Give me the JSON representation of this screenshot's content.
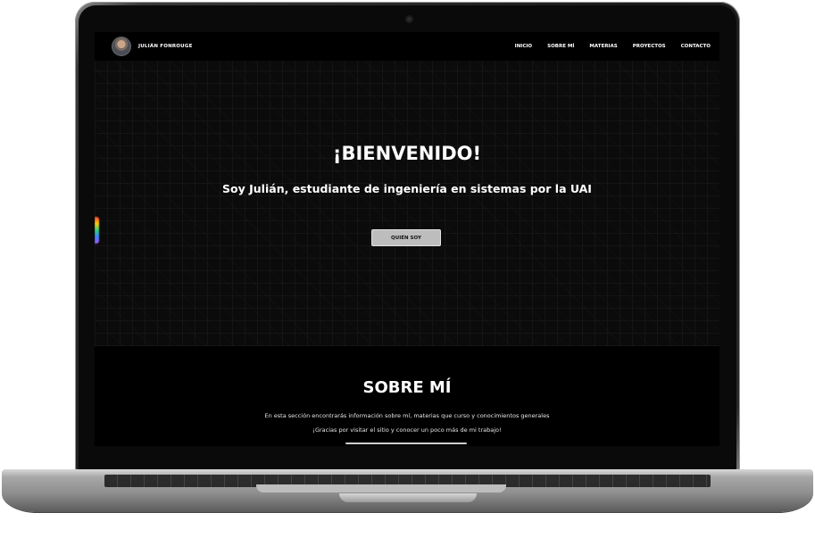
{
  "site": {
    "brand_name": "JULIÁN FONROUGE",
    "nav": [
      {
        "label": "INICIO"
      },
      {
        "label": "SOBRE MÍ"
      },
      {
        "label": "MATERIAS"
      },
      {
        "label": "PROYECTOS"
      },
      {
        "label": "CONTACTO"
      }
    ],
    "hero": {
      "title": "¡BIENVENIDO!",
      "subtitle": "Soy Julián, estudiante de ingeniería en sistemas por la UAI",
      "button_label": "QUIÉN SOY"
    },
    "about": {
      "title": "SOBRE MÍ",
      "line1": "En esta sección encontrarás información sobre mí, materias que curso y conocimientos generales",
      "line2": "¡Gracias por visitar el sitio y conocer un poco más de mi trabajo!"
    }
  },
  "colors": {
    "background": "#000000",
    "text": "#ffffff",
    "button": "#bdbdbd"
  }
}
